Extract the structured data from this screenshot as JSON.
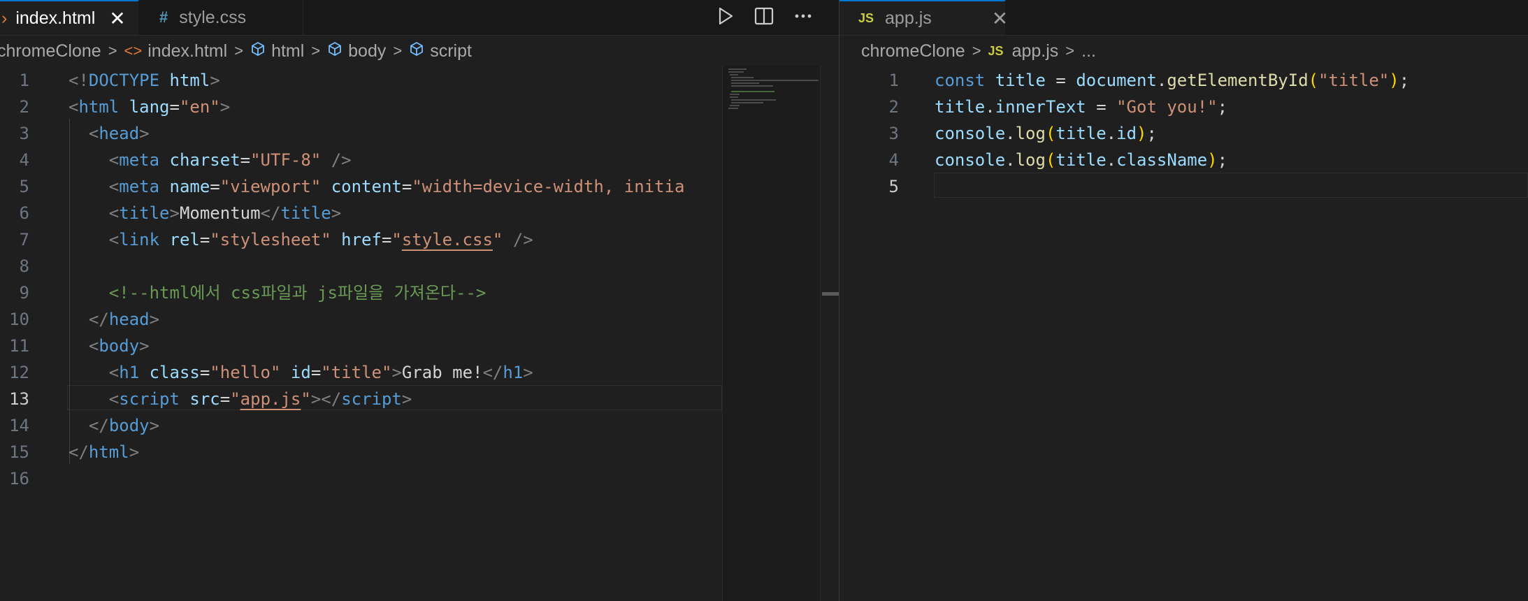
{
  "left_pane": {
    "tabs": [
      {
        "label": "index.html",
        "icon": "›",
        "close": "✕",
        "active": true
      },
      {
        "label": "style.css",
        "icon": "#",
        "active": false
      }
    ],
    "actions": [
      "run-icon",
      "split-editor-icon",
      "more-actions-icon"
    ],
    "breadcrumb": {
      "folder": "chromeClone",
      "file": "index.html",
      "file_icon": "<>",
      "items": [
        "html",
        "body",
        "script"
      ],
      "item_icon": "symbol-structure-icon"
    },
    "current_line": 13,
    "lines": [
      {
        "n": "1",
        "tokens": [
          [
            "punc",
            "<!"
          ],
          [
            "tag",
            "DOCTYPE"
          ],
          [
            "text",
            " "
          ],
          [
            "attr",
            "html"
          ],
          [
            "punc",
            ">"
          ]
        ]
      },
      {
        "n": "2",
        "tokens": [
          [
            "punc",
            "<"
          ],
          [
            "tag",
            "html"
          ],
          [
            "text",
            " "
          ],
          [
            "attr",
            "lang"
          ],
          [
            "text",
            "="
          ],
          [
            "str",
            "\"en\""
          ],
          [
            "punc",
            ">"
          ]
        ]
      },
      {
        "n": "3",
        "tokens": [
          [
            "text",
            "  "
          ],
          [
            "punc",
            "<"
          ],
          [
            "tag",
            "head"
          ],
          [
            "punc",
            ">"
          ]
        ]
      },
      {
        "n": "4",
        "tokens": [
          [
            "text",
            "    "
          ],
          [
            "punc",
            "<"
          ],
          [
            "tag",
            "meta"
          ],
          [
            "text",
            " "
          ],
          [
            "attr",
            "charset"
          ],
          [
            "text",
            "="
          ],
          [
            "str",
            "\"UTF-8\""
          ],
          [
            "text",
            " "
          ],
          [
            "punc",
            "/>"
          ]
        ]
      },
      {
        "n": "5",
        "tokens": [
          [
            "text",
            "    "
          ],
          [
            "punc",
            "<"
          ],
          [
            "tag",
            "meta"
          ],
          [
            "text",
            " "
          ],
          [
            "attr",
            "name"
          ],
          [
            "text",
            "="
          ],
          [
            "str",
            "\"viewport\""
          ],
          [
            "text",
            " "
          ],
          [
            "attr",
            "content"
          ],
          [
            "text",
            "="
          ],
          [
            "str",
            "\"width=device-width, initia"
          ]
        ]
      },
      {
        "n": "6",
        "tokens": [
          [
            "text",
            "    "
          ],
          [
            "punc",
            "<"
          ],
          [
            "tag",
            "title"
          ],
          [
            "punc",
            ">"
          ],
          [
            "text",
            "Momentum"
          ],
          [
            "punc",
            "</"
          ],
          [
            "tag",
            "title"
          ],
          [
            "punc",
            ">"
          ]
        ]
      },
      {
        "n": "7",
        "tokens": [
          [
            "text",
            "    "
          ],
          [
            "punc",
            "<"
          ],
          [
            "tag",
            "link"
          ],
          [
            "text",
            " "
          ],
          [
            "attr",
            "rel"
          ],
          [
            "text",
            "="
          ],
          [
            "str",
            "\"stylesheet\""
          ],
          [
            "text",
            " "
          ],
          [
            "attr",
            "href"
          ],
          [
            "text",
            "="
          ],
          [
            "str",
            "\""
          ],
          [
            "link",
            "style.css"
          ],
          [
            "str",
            "\""
          ],
          [
            "text",
            " "
          ],
          [
            "punc",
            "/>"
          ]
        ]
      },
      {
        "n": "8",
        "tokens": []
      },
      {
        "n": "9",
        "tokens": [
          [
            "text",
            "    "
          ],
          [
            "com",
            "<!--html에서 css파일과 js파일을 가져온다-->"
          ]
        ]
      },
      {
        "n": "10",
        "tokens": [
          [
            "text",
            "  "
          ],
          [
            "punc",
            "</"
          ],
          [
            "tag",
            "head"
          ],
          [
            "punc",
            ">"
          ]
        ]
      },
      {
        "n": "11",
        "tokens": [
          [
            "text",
            "  "
          ],
          [
            "punc",
            "<"
          ],
          [
            "tag",
            "body"
          ],
          [
            "punc",
            ">"
          ]
        ]
      },
      {
        "n": "12",
        "tokens": [
          [
            "text",
            "    "
          ],
          [
            "punc",
            "<"
          ],
          [
            "tag",
            "h1"
          ],
          [
            "text",
            " "
          ],
          [
            "attr",
            "class"
          ],
          [
            "text",
            "="
          ],
          [
            "str",
            "\"hello\""
          ],
          [
            "text",
            " "
          ],
          [
            "attr",
            "id"
          ],
          [
            "text",
            "="
          ],
          [
            "str",
            "\"title\""
          ],
          [
            "punc",
            ">"
          ],
          [
            "text",
            "Grab me!"
          ],
          [
            "punc",
            "</"
          ],
          [
            "tag",
            "h1"
          ],
          [
            "punc",
            ">"
          ]
        ]
      },
      {
        "n": "13",
        "tokens": [
          [
            "text",
            "    "
          ],
          [
            "punc",
            "<"
          ],
          [
            "tag",
            "script"
          ],
          [
            "text",
            " "
          ],
          [
            "attr",
            "src"
          ],
          [
            "text",
            "="
          ],
          [
            "str",
            "\""
          ],
          [
            "link",
            "app.js"
          ],
          [
            "str",
            "\""
          ],
          [
            "punc",
            "></"
          ],
          [
            "tag",
            "script"
          ],
          [
            "punc",
            ">"
          ]
        ]
      },
      {
        "n": "14",
        "tokens": [
          [
            "text",
            "  "
          ],
          [
            "punc",
            "</"
          ],
          [
            "tag",
            "body"
          ],
          [
            "punc",
            ">"
          ]
        ]
      },
      {
        "n": "15",
        "tokens": [
          [
            "punc",
            "</"
          ],
          [
            "tag",
            "html"
          ],
          [
            "punc",
            ">"
          ]
        ]
      },
      {
        "n": "16",
        "tokens": []
      }
    ]
  },
  "right_pane": {
    "tabs": [
      {
        "label": "app.js",
        "icon": "JS",
        "close": "✕",
        "active": true
      }
    ],
    "breadcrumb": {
      "folder": "chromeClone",
      "file": "app.js",
      "file_icon": "JS",
      "items": [
        "..."
      ]
    },
    "current_line": 5,
    "lines": [
      {
        "n": "1",
        "tokens": [
          [
            "kw",
            "const"
          ],
          [
            "text",
            " "
          ],
          [
            "var",
            "title"
          ],
          [
            "op",
            " = "
          ],
          [
            "var",
            "document"
          ],
          [
            "op",
            "."
          ],
          [
            "fn",
            "getElementById"
          ],
          [
            "br",
            "("
          ],
          [
            "str",
            "\"title\""
          ],
          [
            "br",
            ")"
          ],
          [
            "op",
            ";"
          ]
        ]
      },
      {
        "n": "2",
        "tokens": [
          [
            "var",
            "title"
          ],
          [
            "op",
            "."
          ],
          [
            "var",
            "innerText"
          ],
          [
            "op",
            " = "
          ],
          [
            "str",
            "\"Got you!\""
          ],
          [
            "op",
            ";"
          ]
        ]
      },
      {
        "n": "3",
        "tokens": [
          [
            "var",
            "console"
          ],
          [
            "op",
            "."
          ],
          [
            "fn",
            "log"
          ],
          [
            "br",
            "("
          ],
          [
            "var",
            "title"
          ],
          [
            "op",
            "."
          ],
          [
            "var",
            "id"
          ],
          [
            "br",
            ")"
          ],
          [
            "op",
            ";"
          ]
        ]
      },
      {
        "n": "4",
        "tokens": [
          [
            "var",
            "console"
          ],
          [
            "op",
            "."
          ],
          [
            "fn",
            "log"
          ],
          [
            "br",
            "("
          ],
          [
            "var",
            "title"
          ],
          [
            "op",
            "."
          ],
          [
            "var",
            "className"
          ],
          [
            "br",
            ")"
          ],
          [
            "op",
            ";"
          ]
        ]
      },
      {
        "n": "5",
        "tokens": []
      }
    ]
  },
  "colors": {
    "background": "#1f1f1f",
    "tabbar": "#181818",
    "accent": "#0078d4",
    "html_icon": "#e37933",
    "css_icon": "#519aba",
    "js_icon": "#cbcb41",
    "tag": "#569cd6",
    "attr": "#9cdcfe",
    "string": "#ce9178",
    "comment": "#6a9955",
    "function": "#dcdcaa",
    "bracket": "#ffd700"
  }
}
